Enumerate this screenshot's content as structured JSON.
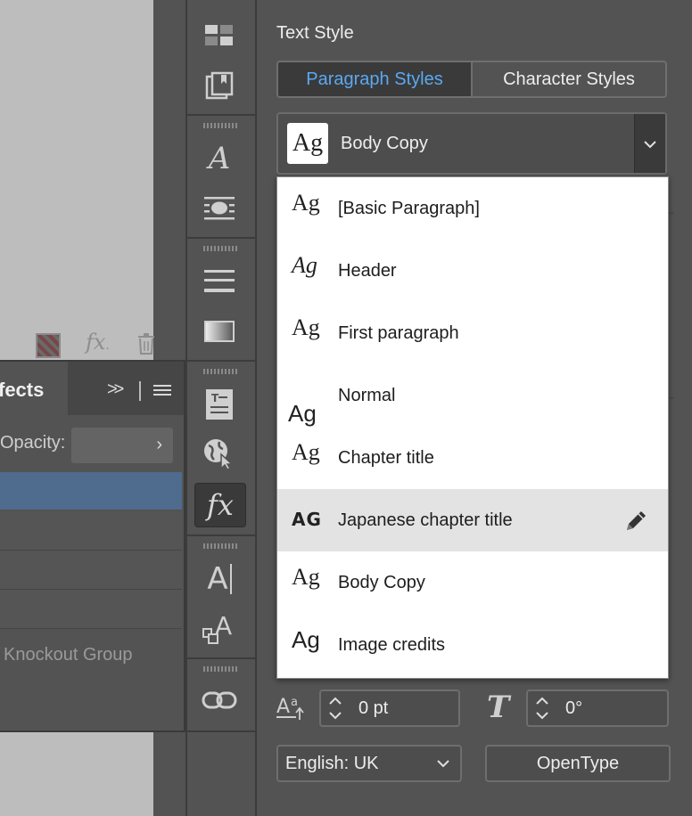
{
  "effects_panel": {
    "title": "fects",
    "opacity_label": "Opacity:",
    "knockout_label": "Knockout Group"
  },
  "text_style_panel": {
    "title": "Text Style",
    "tabs": [
      {
        "label": "Paragraph Styles",
        "active": true
      },
      {
        "label": "Character Styles",
        "active": false
      }
    ],
    "selected_style": {
      "preview": "Ag",
      "label": "Body Copy"
    },
    "style_list": [
      {
        "preview": "Ag",
        "label": "[Basic Paragraph]"
      },
      {
        "preview": "Ag",
        "label": "Header"
      },
      {
        "preview": "Ag",
        "label": "First paragraph"
      },
      {
        "preview": "Ag",
        "label": "Normal"
      },
      {
        "preview": "Ag",
        "label": "Chapter title"
      },
      {
        "preview": "AG",
        "label": "Japanese chapter title",
        "highlighted": true
      },
      {
        "preview": "Ag",
        "label": "Body Copy"
      },
      {
        "preview": "Ag",
        "label": "Image credits"
      }
    ],
    "baseline_shift": "0 pt",
    "skew": "0°",
    "language": "English: UK",
    "opentype_label": "OpenType"
  },
  "colors": {
    "panel_bg": "#535353",
    "accent": "#5aa9f2",
    "selection": "#4f6b8e"
  }
}
